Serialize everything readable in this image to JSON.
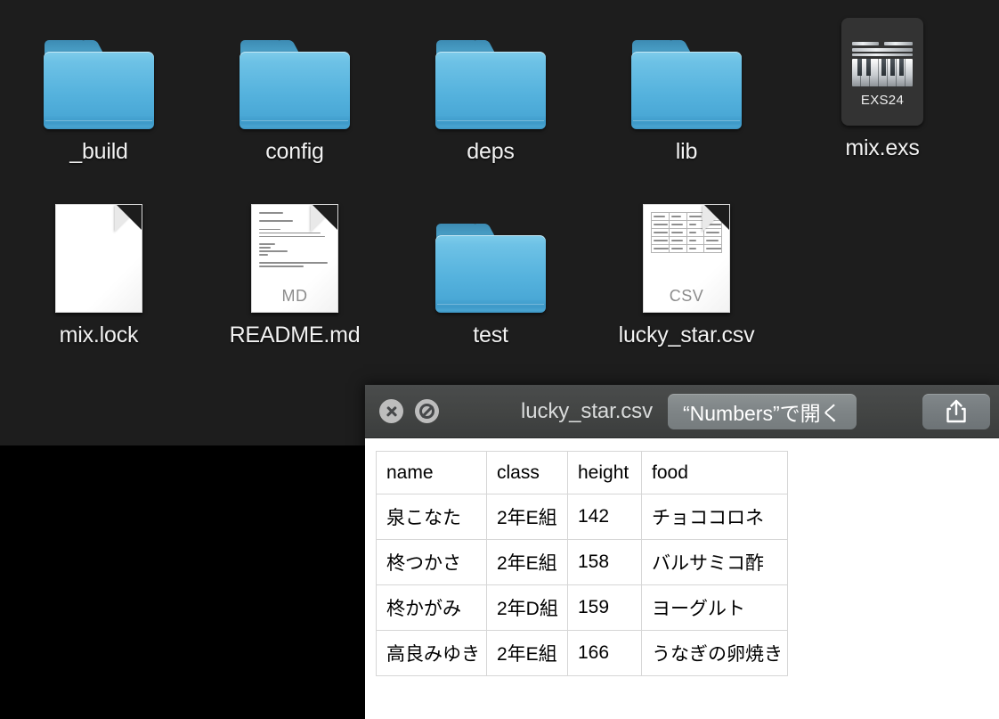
{
  "desktop": {
    "background_upper": "#1d1d1d",
    "background_lower": "#000000",
    "icons": [
      {
        "label": "_build",
        "kind": "folder",
        "badge": ""
      },
      {
        "label": "config",
        "kind": "folder",
        "badge": ""
      },
      {
        "label": "deps",
        "kind": "folder",
        "badge": ""
      },
      {
        "label": "lib",
        "kind": "folder",
        "badge": ""
      },
      {
        "label": "mix.exs",
        "kind": "exs24",
        "badge": "EXS24"
      },
      {
        "label": "mix.lock",
        "kind": "document",
        "badge": ""
      },
      {
        "label": "README.md",
        "kind": "document",
        "badge": "MD"
      },
      {
        "label": "test",
        "kind": "folder",
        "badge": ""
      },
      {
        "label": "lucky_star.csv",
        "kind": "document",
        "badge": "CSV"
      }
    ]
  },
  "quicklook": {
    "title": "lucky_star.csv",
    "open_button_label": "“Numbers”で開く",
    "close_icon": "close-circle-icon",
    "fullscreen_icon": "no-entry-circle-icon",
    "share_icon": "share-icon",
    "toolbar_bg": "#434544",
    "preview": {
      "type": "table",
      "columns": [
        "name",
        "class",
        "height",
        "food"
      ],
      "rows": [
        [
          "泉こなた",
          "2年E組",
          "142",
          "チョココロネ"
        ],
        [
          "柊つかさ",
          "2年E組",
          "158",
          "バルサミコ酢"
        ],
        [
          "柊かがみ",
          "2年D組",
          "159",
          "ヨーグルト"
        ],
        [
          "高良みゆき",
          "2年E組",
          "166",
          "うなぎの卵焼き"
        ]
      ]
    }
  }
}
